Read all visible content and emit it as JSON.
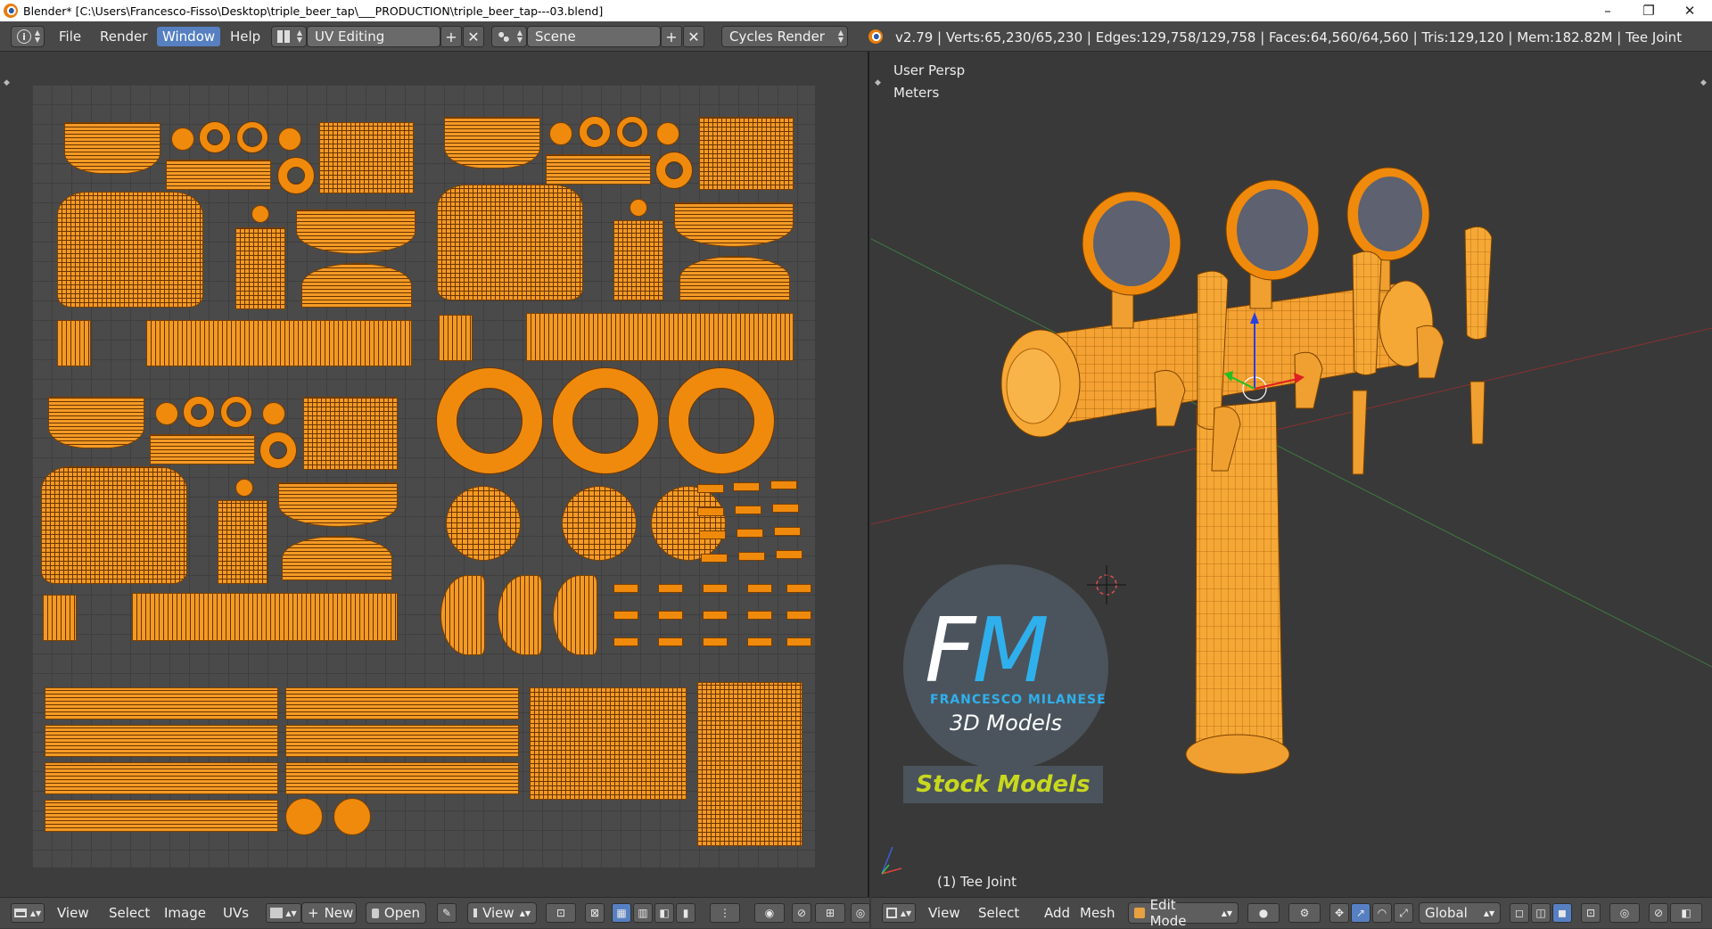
{
  "window": {
    "title": "Blender* [C:\\Users\\Francesco-Fisso\\Desktop\\triple_beer_tap\\___PRODUCTION\\triple_beer_tap---03.blend]",
    "minimize": "–",
    "restore": "❐",
    "close": "✕"
  },
  "info_header": {
    "editor_icon": "i",
    "menus": [
      "File",
      "Render",
      "Window",
      "Help"
    ],
    "active_menu": "Window",
    "screen_layout": "UV Editing",
    "scene": "Scene",
    "render_engine": "Cycles Render",
    "stats": "v2.79 | Verts:65,230/65,230 | Edges:129,758/129,758 | Faces:64,560/64,560 | Tris:129,120 | Mem:182.82M | Tee Joint"
  },
  "viewport": {
    "view_name": "User Persp",
    "units": "Meters",
    "object_label": "(1) Tee Joint"
  },
  "logo": {
    "f": "F",
    "m": "M",
    "line1": "FRANCESCO MILANESE",
    "line2": "3D Models",
    "banner": "Stock Models"
  },
  "uv_footer": {
    "menus": [
      "View",
      "Select",
      "Image",
      "UVs"
    ],
    "new_label": "New",
    "open_label": "Open",
    "view_label": "View"
  },
  "vp_footer": {
    "menus": [
      "View",
      "Select",
      "Add",
      "Mesh"
    ],
    "mode": "Edit Mode",
    "orientation": "Global"
  },
  "colors": {
    "accent": "#5680c2",
    "mesh_selected": "#f08a0d",
    "logo_blue": "#2fb0ec",
    "stock_text": "#c8d81e"
  }
}
